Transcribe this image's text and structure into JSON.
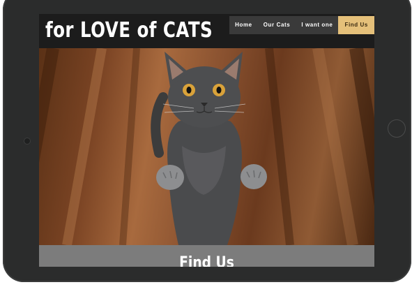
{
  "site": {
    "logo": "for LOVE of CATS"
  },
  "nav": {
    "items": [
      {
        "label": "Home",
        "active": false
      },
      {
        "label": "Our Cats",
        "active": false
      },
      {
        "label": "I want one",
        "active": false
      },
      {
        "label": "Find Us",
        "active": true
      }
    ]
  },
  "hero": {
    "image": "gray-kitten-standing-icon"
  },
  "section": {
    "title": "Find Us"
  },
  "colors": {
    "nav_active": "#e5c07a",
    "header_bg": "#1c1c1c",
    "section_bg": "#7c7c7c",
    "tablet_frame": "#2b2c2c"
  }
}
